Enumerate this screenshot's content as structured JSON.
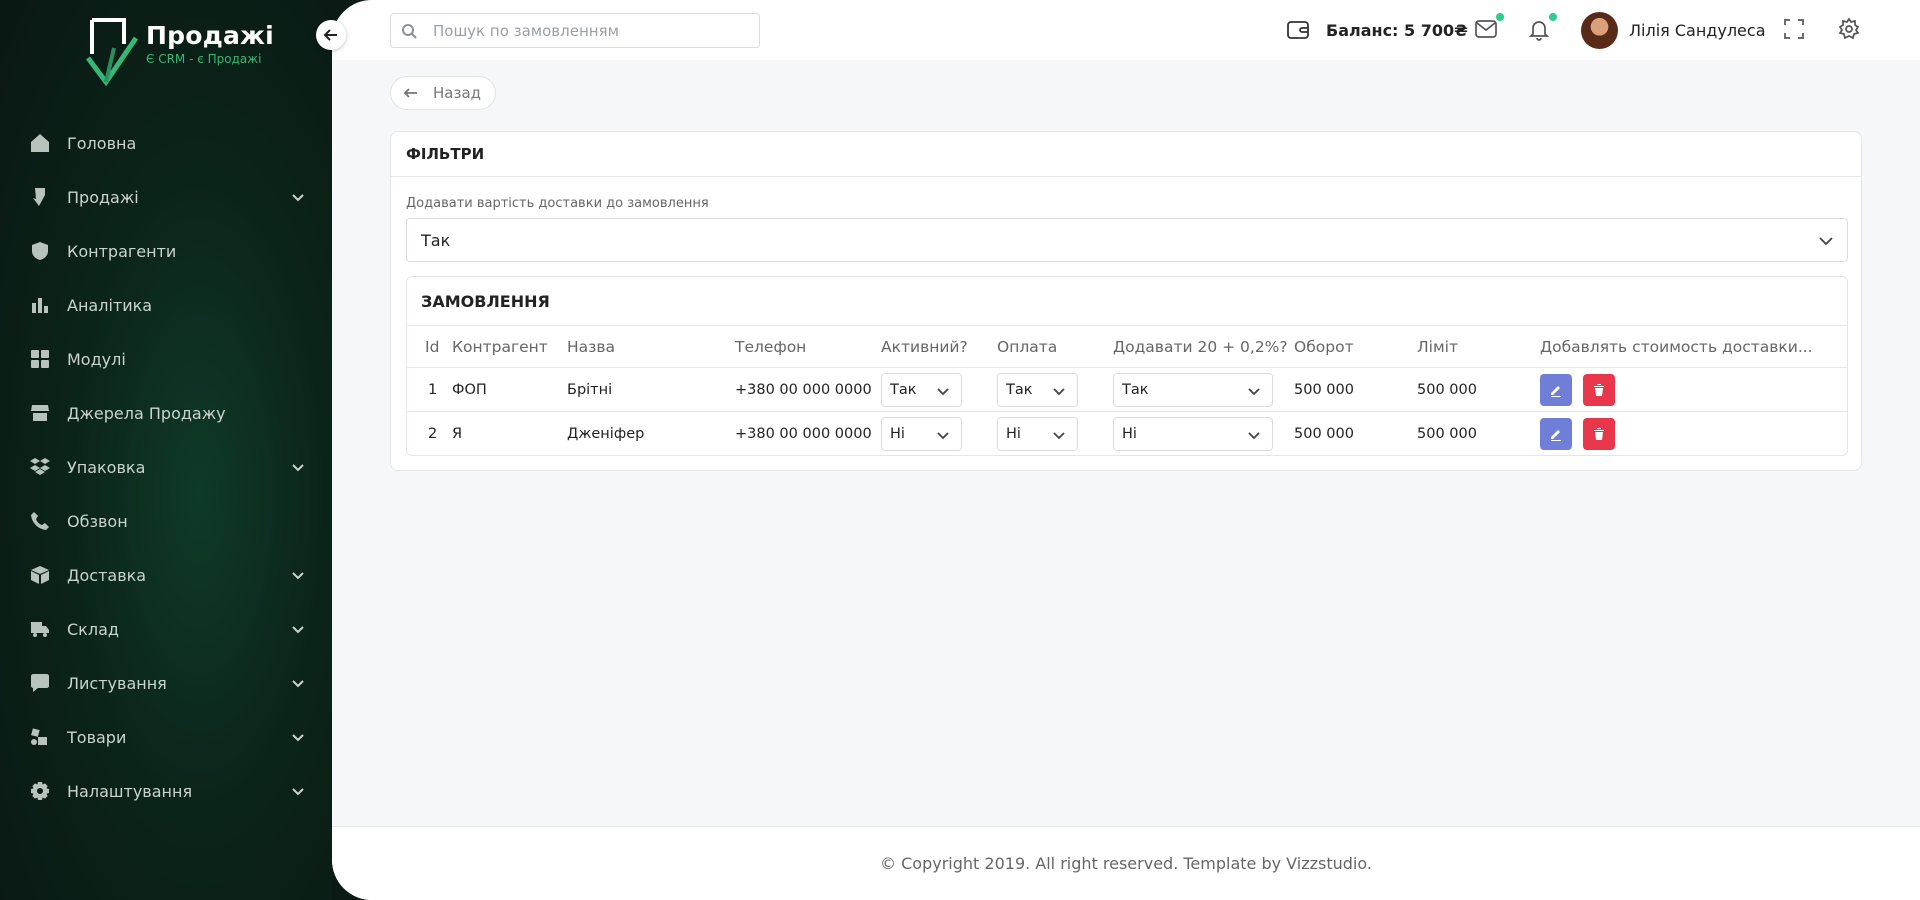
{
  "brand": {
    "title": "Продажі",
    "subtitle": "Є CRM - є Продажі"
  },
  "sidebar": {
    "items": [
      {
        "label": "Головна",
        "icon": "home-icon",
        "expandable": false
      },
      {
        "label": "Продажі",
        "icon": "sales-icon",
        "expandable": true
      },
      {
        "label": "Контрагенти",
        "icon": "user-shield-icon",
        "expandable": false
      },
      {
        "label": "Аналітика",
        "icon": "chart-icon",
        "expandable": false
      },
      {
        "label": "Модулі",
        "icon": "grid-icon",
        "expandable": false
      },
      {
        "label": "Джерела Продажу",
        "icon": "store-icon",
        "expandable": false
      },
      {
        "label": "Упаковка",
        "icon": "dropbox-icon",
        "expandable": true
      },
      {
        "label": "Обзвон",
        "icon": "phone-icon",
        "expandable": false
      },
      {
        "label": "Доставка",
        "icon": "box-icon",
        "expandable": true
      },
      {
        "label": "Склад",
        "icon": "truck-icon",
        "expandable": true
      },
      {
        "label": "Листування",
        "icon": "chat-icon",
        "expandable": true
      },
      {
        "label": "Товари",
        "icon": "boxes-icon",
        "expandable": true
      },
      {
        "label": "Налаштування",
        "icon": "gear-icon",
        "expandable": true
      }
    ]
  },
  "header": {
    "search_placeholder": "Пошук по замовленням",
    "balance": "Баланс: 5 700₴",
    "user_name": "Лілія Сандулеса"
  },
  "back_label": "Назад",
  "filters": {
    "title": "ФІЛЬТРИ",
    "delivery_label": "Додавати вартість доставки до замовлення",
    "delivery_value": "Так"
  },
  "orders": {
    "title": "ЗАМОВЛЕННЯ",
    "columns": [
      "Id",
      "Контрагент",
      "Назва",
      "Телефон",
      "Активний?",
      "Оплата",
      "Додавати 20 + 0,2%?",
      "Оборот",
      "Ліміт",
      "Добавлять стоимость доставки..."
    ],
    "rows": [
      {
        "id": "1",
        "counterparty": "ФОП",
        "name": "Брітні",
        "phone": "+380 00 000 0000",
        "active": "Так",
        "payment": "Так",
        "add_fee": "Так",
        "turnover": "500 000",
        "limit": "500 000"
      },
      {
        "id": "2",
        "counterparty": "Я",
        "name": "Дженіфер",
        "phone": "+380 00 000 0000",
        "active": "Ні",
        "payment": "Ні",
        "add_fee": "Ні",
        "turnover": "500 000",
        "limit": "500 000"
      }
    ]
  },
  "footer": "© Copyright 2019. All right reserved. Template by Vizzstudio.",
  "colors": {
    "sidebar_bg": "#0b2419",
    "accent_green": "#37b777",
    "edit_button": "#6f7fd8",
    "delete_button": "#e8364b",
    "notification_dot": "#2ecc8b"
  }
}
